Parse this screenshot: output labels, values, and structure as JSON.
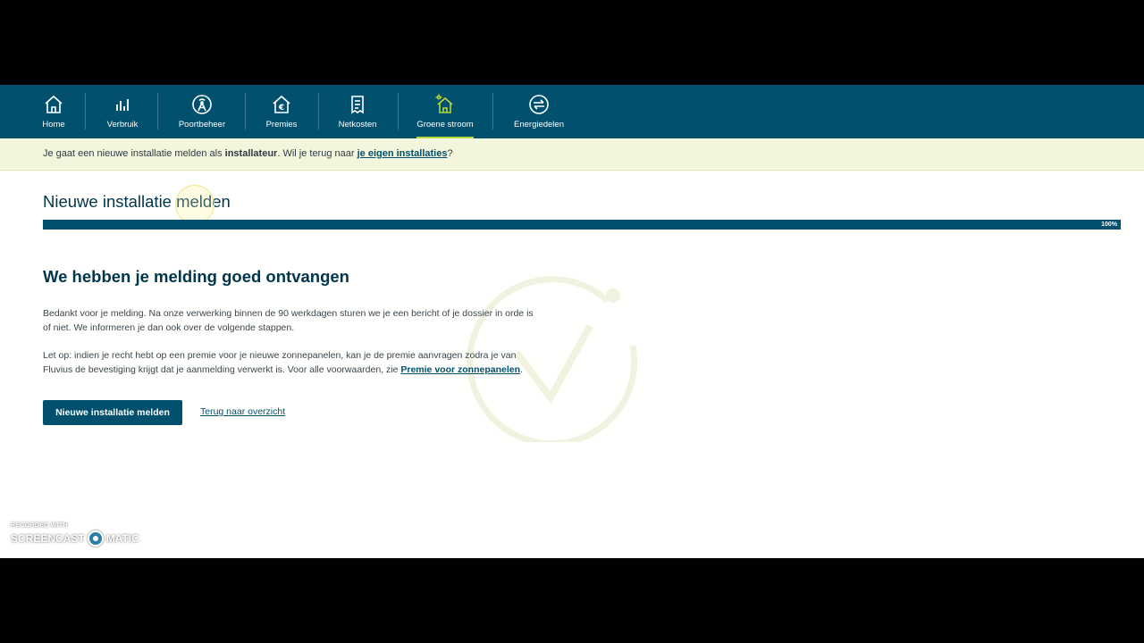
{
  "nav": {
    "items": [
      {
        "label": "Home",
        "icon": "home-icon"
      },
      {
        "label": "Verbruik",
        "icon": "bar-chart-icon"
      },
      {
        "label": "Poortbeheer",
        "icon": "antenna-icon"
      },
      {
        "label": "Premies",
        "icon": "euro-house-icon"
      },
      {
        "label": "Netkosten",
        "icon": "invoice-icon"
      },
      {
        "label": "Groene stroom",
        "icon": "solar-house-icon",
        "active": true
      },
      {
        "label": "Energiedelen",
        "icon": "exchange-icon"
      }
    ]
  },
  "banner": {
    "prefix": "Je gaat een nieuwe installatie melden als ",
    "role": "installateur",
    "middle": ". Wil je terug naar ",
    "link": "je eigen installaties",
    "suffix": "?"
  },
  "page": {
    "title": "Nieuwe installatie melden",
    "progress_label": "100%",
    "progress_value": 1.0
  },
  "confirmation": {
    "title": "We hebben je melding goed ontvangen",
    "para1": "Bedankt voor je melding. Na onze verwerking binnen de 90 werkdagen sturen we je een bericht of je dossier in orde is of niet. We informeren je dan ook over de volgende stappen.",
    "para2_text": "Let op: indien je recht hebt op een premie voor je nieuwe zonnepanelen, kan je de premie aanvragen zodra je van Fluvius de bevestiging krijgt dat je aanmelding verwerkt is. Voor alle voorwaarden, zie ",
    "para2_link": "Premie voor zonnepanelen",
    "para2_end": ".",
    "primary_button": "Nieuwe installatie melden",
    "back_link": "Terug naar overzicht"
  },
  "recorder": {
    "top": "RECORDED WITH",
    "left": "SCREENCAST",
    "right": "MATIC"
  },
  "colors": {
    "nav_bg": "#00506e",
    "accent": "#b6d63a",
    "banner_bg": "#f3f5dc",
    "title": "#00364d"
  }
}
